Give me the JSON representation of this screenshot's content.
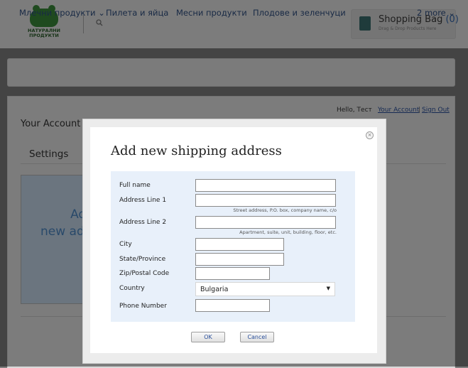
{
  "header": {
    "logo_line1": "НАТУРАЛНИ",
    "logo_line2": "ПРОДУКТИ",
    "search_icon": "search-icon",
    "bag_title": "Shopping Bag",
    "bag_count": "(0)",
    "bag_sub": "Drag & Drop Products Here"
  },
  "nav": {
    "items": [
      "Млечни продукти",
      "Пилета и яйца",
      "Месни продукти",
      "Плодове и зеленчуци"
    ],
    "dropdown_chevron": "⌄",
    "more": "2 more ⌄"
  },
  "account": {
    "hello": "Hello, Тест",
    "your_account_link": "Your Account",
    "separator": "|",
    "sign_out": "Sign Out",
    "page_title": "Your Account",
    "settings_tab": "Settings",
    "add_line1": "Add",
    "add_line2": "new address"
  },
  "modal": {
    "title": "Add new shipping address",
    "close_icon": "close-icon",
    "fields": {
      "full_name": {
        "label": "Full name",
        "value": ""
      },
      "address1": {
        "label": "Address Line 1",
        "value": "",
        "hint": "Street address, P.O. box, company name, c/o"
      },
      "address2": {
        "label": "Address Line 2",
        "value": "",
        "hint": "Apartment, suite, unit, building, floor, etc."
      },
      "city": {
        "label": "City",
        "value": ""
      },
      "state": {
        "label": "State/Province",
        "value": ""
      },
      "zip": {
        "label": "Zip/Postal Code",
        "value": ""
      },
      "country": {
        "label": "Country",
        "value": "Bulgaria"
      },
      "phone": {
        "label": "Phone Number",
        "value": ""
      }
    },
    "ok": "OK",
    "cancel": "Cancel"
  }
}
